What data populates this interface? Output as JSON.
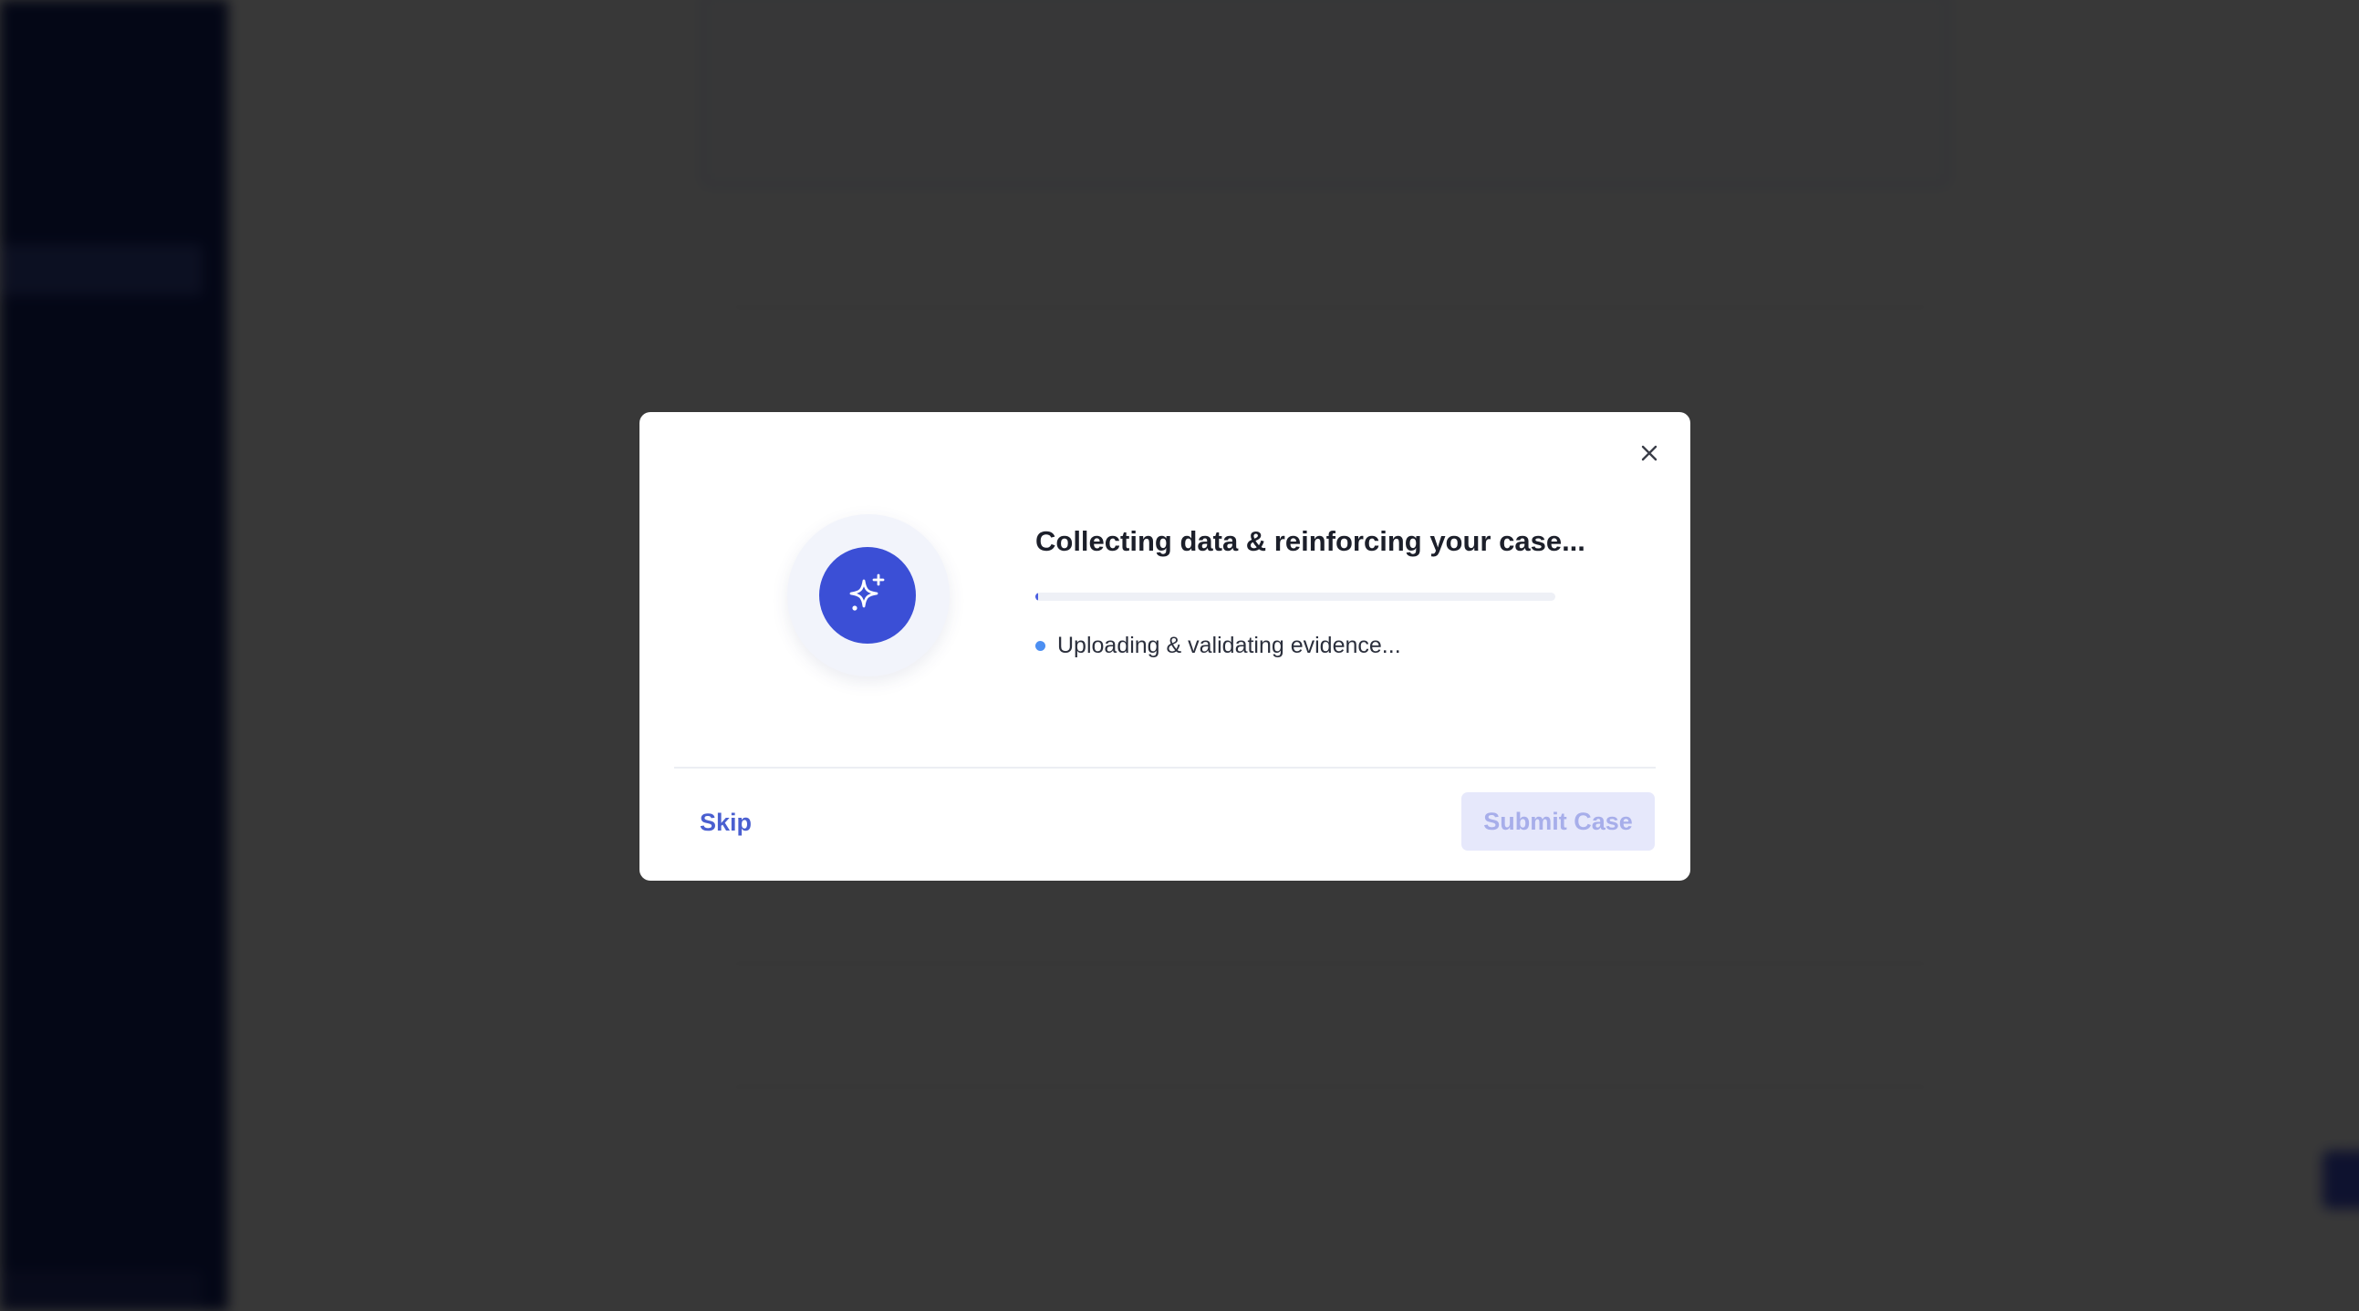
{
  "modal": {
    "title": "Collecting data & reinforcing your case...",
    "status_text": "Uploading & validating evidence...",
    "progress_fraction": 0.005,
    "skip_label": "Skip",
    "submit_label": "Submit Case",
    "icon": "sparkles-icon",
    "close_icon": "close-icon"
  },
  "colors": {
    "accent": "#3b4fd6",
    "status_dot": "#4c8ff2",
    "submit_disabled_bg": "#e6e8fb",
    "submit_disabled_text": "#a7aeea",
    "sidebar": "#122066"
  }
}
